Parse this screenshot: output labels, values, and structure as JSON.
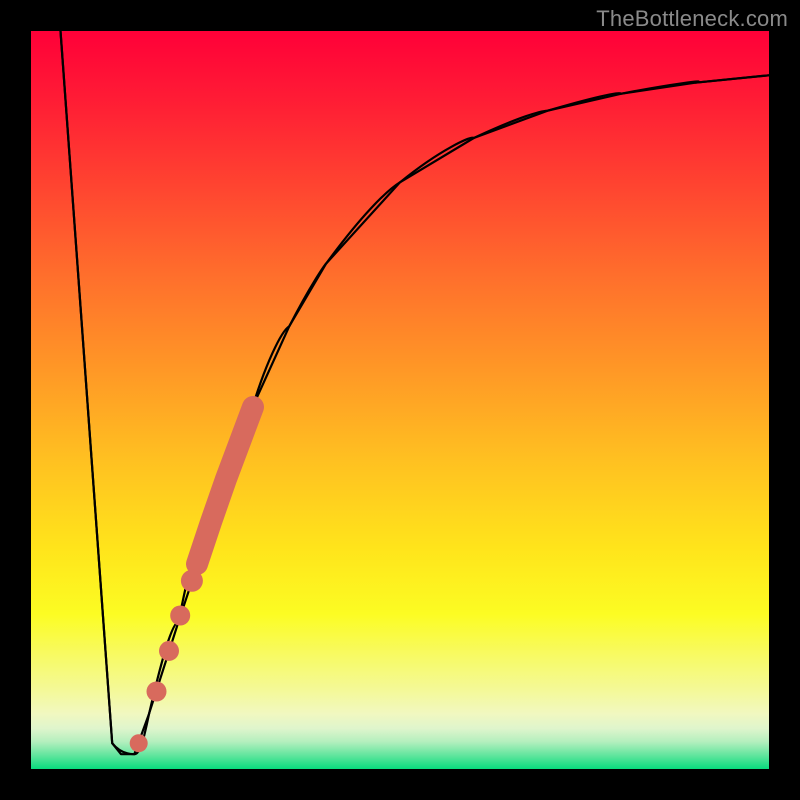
{
  "watermark": "TheBottleneck.com",
  "chart_data": {
    "type": "line",
    "title": "",
    "xlabel": "",
    "ylabel": "",
    "xlim": [
      0,
      100
    ],
    "ylim": [
      0,
      100
    ],
    "grid": false,
    "series": [
      {
        "name": "curve",
        "color": "#000000",
        "points": [
          {
            "x": 4.0,
            "y": 100
          },
          {
            "x": 11.0,
            "y": 3.5
          },
          {
            "x": 12.2,
            "y": 2.0
          },
          {
            "x": 14.0,
            "y": 2.0
          },
          {
            "x": 16.0,
            "y": 7.5
          },
          {
            "x": 20.0,
            "y": 20.0
          },
          {
            "x": 25.0,
            "y": 35.0
          },
          {
            "x": 30.0,
            "y": 49.0
          },
          {
            "x": 35.0,
            "y": 60.0
          },
          {
            "x": 40.0,
            "y": 68.5
          },
          {
            "x": 50.0,
            "y": 79.5
          },
          {
            "x": 60.0,
            "y": 85.5
          },
          {
            "x": 70.0,
            "y": 89.2
          },
          {
            "x": 80.0,
            "y": 91.5
          },
          {
            "x": 90.0,
            "y": 93.0
          },
          {
            "x": 100.0,
            "y": 94.0
          }
        ]
      },
      {
        "name": "markers",
        "color": "#d86a5d",
        "points": [
          {
            "x": 14.6,
            "y": 3.5,
            "r": 1.2
          },
          {
            "x": 17.0,
            "y": 10.5,
            "r": 1.3
          },
          {
            "x": 18.7,
            "y": 16.0,
            "r": 1.3
          },
          {
            "x": 20.2,
            "y": 20.8,
            "r": 1.3
          },
          {
            "x": 21.8,
            "y": 25.5,
            "r": 1.3
          },
          {
            "x": 24.5,
            "y": 33.5,
            "r": 2.1
          },
          {
            "x": 27.3,
            "y": 41.5,
            "r": 2.1
          },
          {
            "x": 30.0,
            "y": 49.0,
            "r": 2.1
          }
        ]
      }
    ],
    "background_gradient": {
      "type": "vertical",
      "stops": [
        {
          "pos": 0.0,
          "color": "#ff0038"
        },
        {
          "pos": 0.46,
          "color": "#ff9826"
        },
        {
          "pos": 0.79,
          "color": "#fcfc23"
        },
        {
          "pos": 1.0,
          "color": "#08dc7d"
        }
      ]
    }
  }
}
